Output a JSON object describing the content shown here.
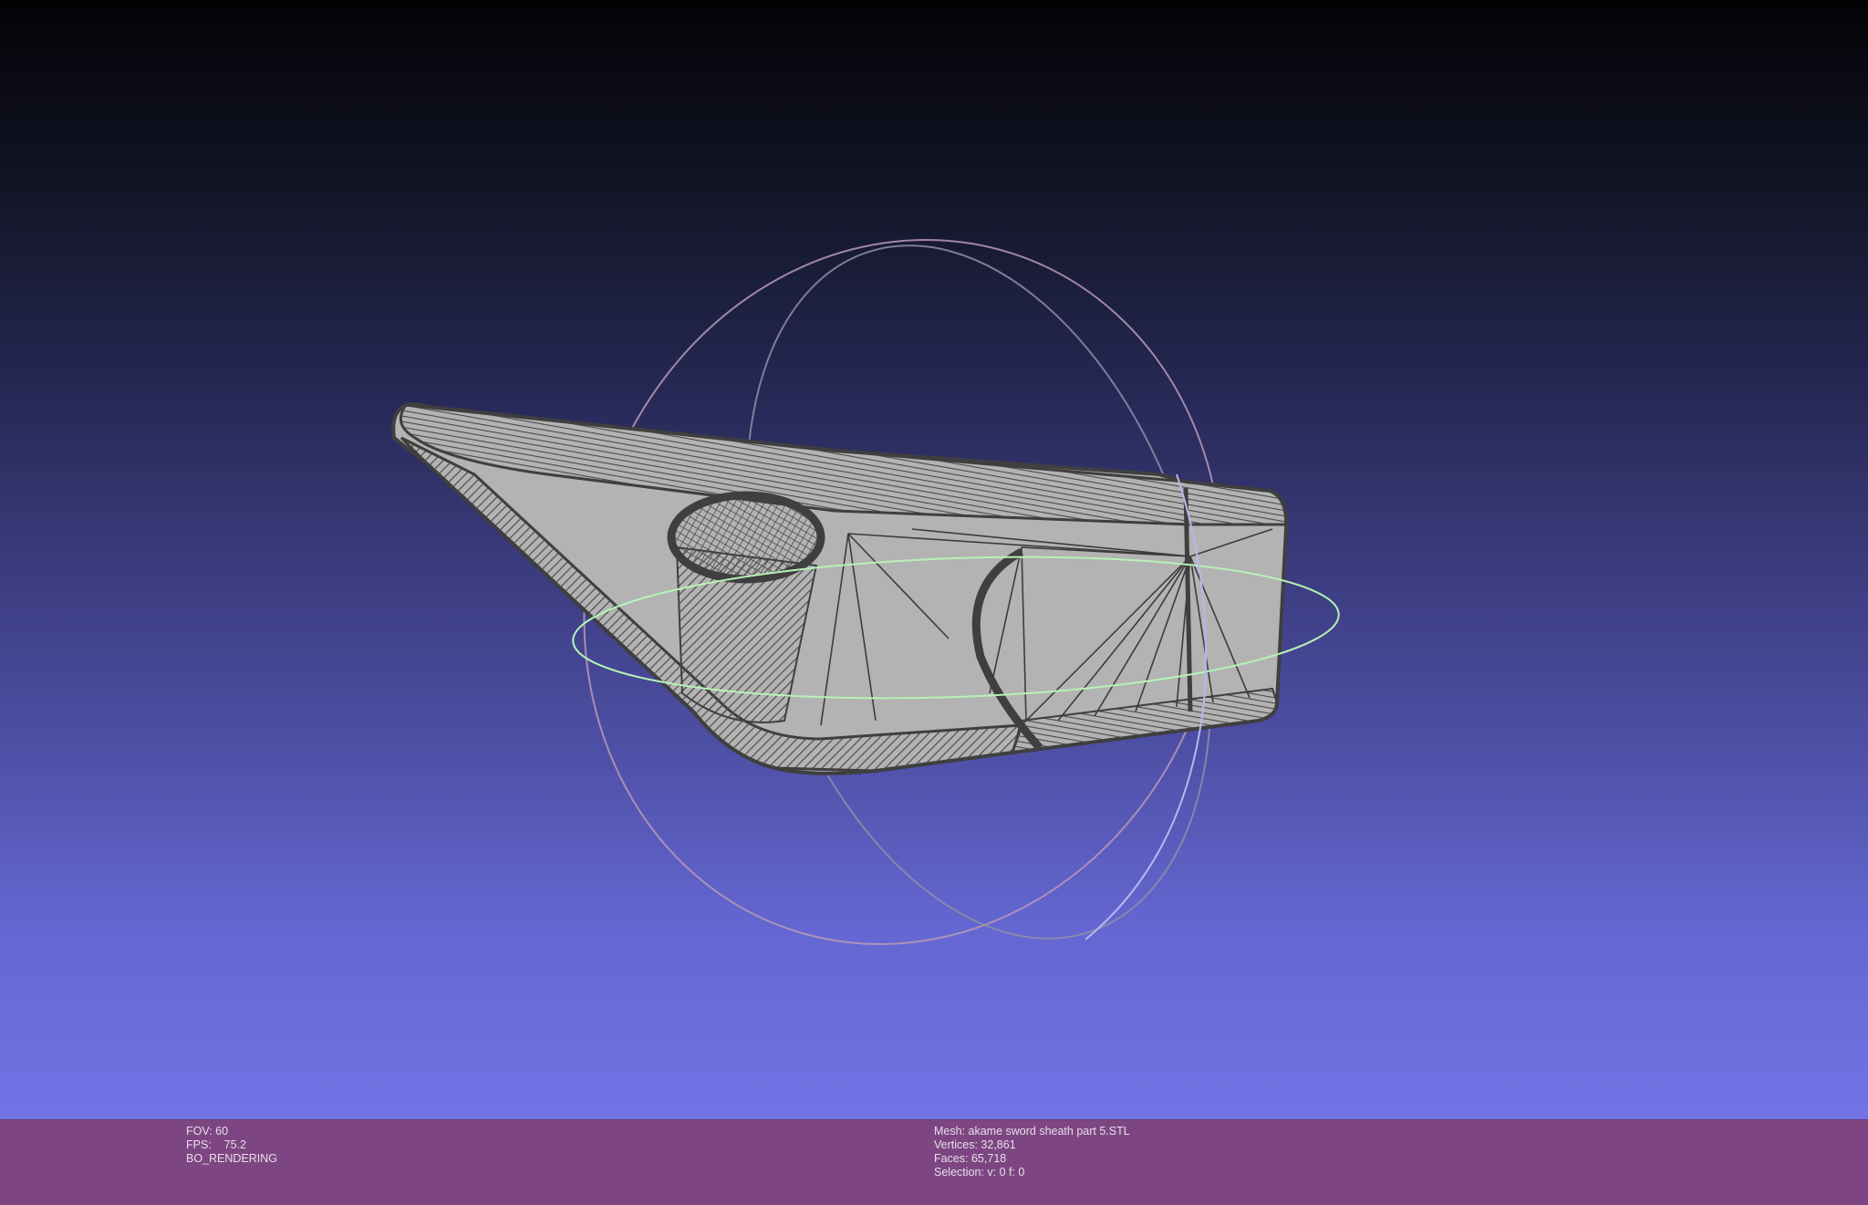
{
  "render_info": {
    "fov": "FOV: 60",
    "fps": "FPS:    75.2",
    "mode": "BO_RENDERING"
  },
  "mesh_info": {
    "mesh": "Mesh: akame sword sheath part 5.STL",
    "vertices": "Vertices: 32,861",
    "faces": "Faces: 65,718",
    "selection": "Selection: v: 0 f: 0"
  },
  "colors": {
    "status_bar": "#7d4682",
    "gradient_top": "#030306",
    "gradient_bottom": "#7274e6",
    "mesh_fill": "#b5b5b5",
    "mesh_wire": "#404040",
    "trackball_x": "#c7a0c8",
    "trackball_y": "#b8b6f0",
    "trackball_z": "#b6f3b8"
  },
  "viewport": {
    "model_name": "sword-sheath-mesh",
    "gizmo": "trackball-gizmo"
  }
}
